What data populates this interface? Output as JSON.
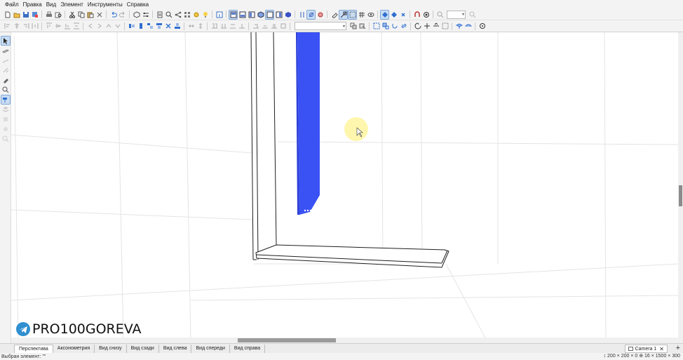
{
  "menu": [
    "Файл",
    "Правка",
    "Вид",
    "Элемент",
    "Инструменты",
    "Справка"
  ],
  "watermark": {
    "text": "PRO100GOREVA",
    "icon": "telegram-icon"
  },
  "view_tabs": [
    "Перспектива",
    "Аксонометрия",
    "Вид снизу",
    "Вид сзади",
    "Вид слева",
    "Вид спереди",
    "Вид справа"
  ],
  "active_view_tab": "Перспектива",
  "camera_tab": {
    "label": "Camera 1",
    "close": "✕",
    "add": "+"
  },
  "status": {
    "left": "Выбран элемент: \"\"",
    "right": "↕ 200 × 200 × 0   ⊕ 16 × 1500 × 300"
  },
  "colors": {
    "selected_panel": "#3a52f4",
    "ui_background": "#f3f3f3",
    "active_button": "#c8dcf2",
    "cursor_highlight": "#fff4a0"
  },
  "toolbar_1_icons": [
    "new-file",
    "open-folder",
    "save",
    "save-as",
    "print",
    "print-preview",
    "cut",
    "copy",
    "paste",
    "delete",
    "undo",
    "redo",
    "properties",
    "settings",
    "library",
    "find",
    "share",
    "components",
    "lightbulb-star",
    "lightbulb",
    "info",
    "view-front",
    "view-top",
    "view-side",
    "view-3d",
    "view-bottom",
    "view-back",
    "view-iso",
    "snap-grid",
    "align",
    "rotate",
    "magnet",
    "select-rect",
    "select-all",
    "grid",
    "eye",
    "point",
    "point-add",
    "point-remove",
    "magnet-2",
    "target",
    "zoom"
  ],
  "toolbar_2_icons": [
    "align-left",
    "align-center",
    "align-right",
    "distribute-h",
    "align-top",
    "align-middle",
    "align-bottom",
    "distribute-v",
    "move-left",
    "move-right",
    "move-up",
    "move-down",
    "snap-left",
    "snap-center",
    "snap-right",
    "snap-top",
    "snap-middle",
    "snap-bottom",
    "join",
    "split",
    "mirror-h",
    "mirror-v",
    "gap",
    "size-w",
    "size-h",
    "size-d",
    "size-equal",
    "fit",
    "group",
    "ungroup",
    "lock",
    "unlock",
    "rotate-cw",
    "rotate-ccw",
    "move",
    "scale",
    "flip",
    "texture",
    "edge",
    "hinge",
    "orbit"
  ],
  "left_toolbar_icons": [
    "select-arrow",
    "panel-tool",
    "line-tool",
    "dimension-tool",
    "eyedropper-tool",
    "rotate-tool",
    "paint-tool",
    "stack-tool",
    "layers-tool",
    "shape-tool",
    "zoom-tool"
  ]
}
